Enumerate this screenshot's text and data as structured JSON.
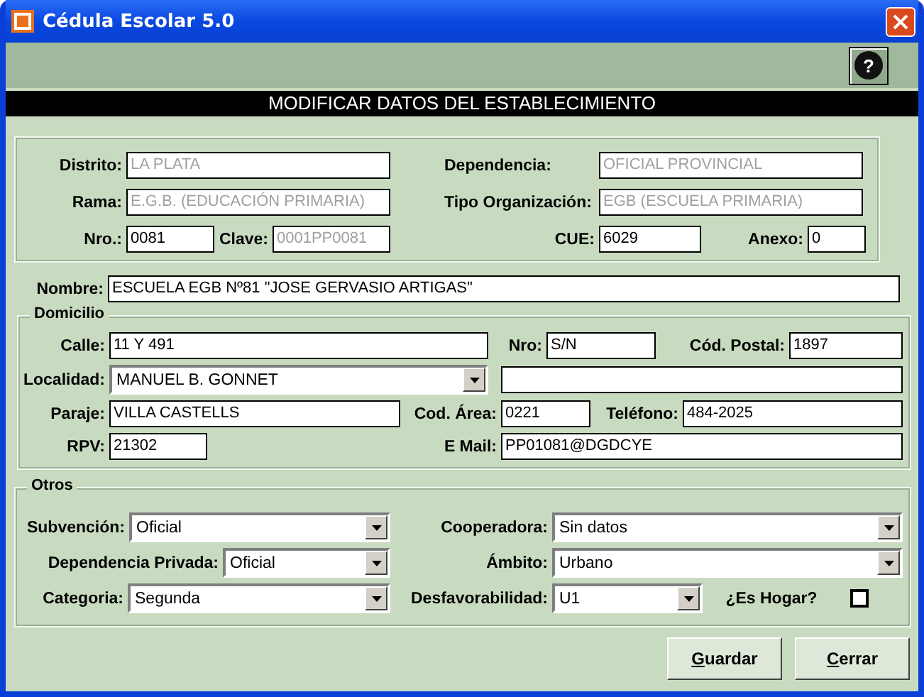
{
  "window": {
    "title": "Cédula Escolar 5.0"
  },
  "help_button": {
    "icon": "?"
  },
  "header": "MODIFICAR DATOS DEL ESTABLECIMIENTO",
  "sections": [
    {
      "kind": "group",
      "rows": [
        [
          {
            "label": "Distrito:",
            "kind": "text",
            "value": "LA PLATA",
            "disabled": true
          },
          {
            "label": "Dependencia:",
            "kind": "text",
            "value": "OFICIAL PROVINCIAL",
            "disabled": true
          }
        ],
        [
          {
            "label": "Rama:",
            "kind": "text",
            "value": "E.G.B. (EDUCACIÓN PRIMARIA)",
            "disabled": true
          },
          {
            "label": "Tipo Organización:",
            "kind": "text",
            "value": "EGB (ESCUELA PRIMARIA)",
            "disabled": true
          }
        ],
        [
          {
            "label": "Nro.:",
            "kind": "text",
            "value": "0081",
            "disabled": false
          },
          {
            "label": "Clave:",
            "kind": "text",
            "value": "0001PP0081",
            "disabled": true
          },
          {
            "label": "CUE:",
            "kind": "text",
            "value": "6029",
            "disabled": false
          },
          {
            "label": "Anexo:",
            "kind": "text",
            "value": "0",
            "disabled": false
          }
        ]
      ]
    },
    {
      "kind": "plain",
      "rows": [
        [
          {
            "label": "Nombre:",
            "kind": "text",
            "value": "ESCUELA EGB Nº81 \"JOSE GERVASIO ARTIGAS\"",
            "disabled": false
          }
        ]
      ]
    },
    {
      "kind": "group",
      "title": "Domicilio",
      "rows": [
        [
          {
            "label": "Calle:",
            "kind": "text",
            "value": "11 Y 491",
            "disabled": false
          },
          {
            "label": "Nro:",
            "kind": "text",
            "value": "S/N",
            "disabled": false
          },
          {
            "label": "Cód. Postal:",
            "kind": "text",
            "value": "1897",
            "disabled": false
          }
        ],
        [
          {
            "label": "Localidad:",
            "kind": "combo",
            "value": "MANUEL B. GONNET"
          },
          {
            "kind": "text"
          }
        ],
        [
          {
            "label": "Paraje:",
            "kind": "text",
            "value": "VILLA CASTELLS",
            "disabled": false
          },
          {
            "label": "Cod. Área:",
            "kind": "text",
            "value": "0221",
            "disabled": false
          },
          {
            "label": "Teléfono:",
            "kind": "text",
            "value": "484-2025",
            "disabled": false
          }
        ],
        [
          {
            "label": "RPV:",
            "kind": "text",
            "value": "21302",
            "disabled": false
          },
          {
            "label": "E Mail:",
            "kind": "text",
            "value": "PP01081@DGDCYE",
            "disabled": false
          }
        ]
      ]
    },
    {
      "kind": "group",
      "title": "Otros",
      "rows": [
        [
          {
            "label": "Subvención:",
            "kind": "combo",
            "value": "Oficial"
          },
          {
            "label": "Cooperadora:",
            "kind": "combo",
            "value": "Sin datos"
          }
        ],
        [
          {
            "label": "Dependencia Privada:",
            "kind": "combo",
            "value": "Oficial"
          },
          {
            "label": "Ámbito:",
            "kind": "combo",
            "value": "Urbano"
          }
        ],
        [
          {
            "label": "Categoria:",
            "kind": "combo",
            "value": "Segunda"
          },
          {
            "label": "Desfavorabilidad:",
            "kind": "combo",
            "value": "U1"
          },
          {
            "label": "¿Es Hogar?",
            "kind": "checkbox",
            "checked": false
          }
        ]
      ]
    }
  ],
  "buttons": [
    {
      "label": "Guardar",
      "mnemonic": true
    },
    {
      "label": "Cerrar",
      "mnemonic": true
    }
  ]
}
